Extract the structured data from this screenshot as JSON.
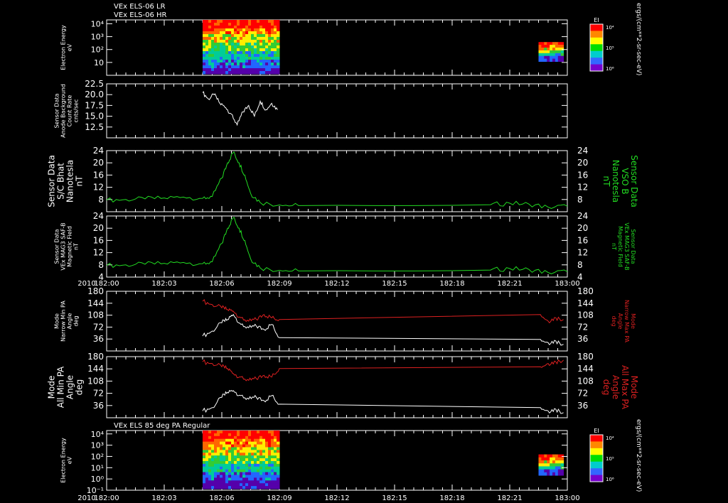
{
  "header": {
    "line1": "VEx ELS-06 LR",
    "line2": "VEx ELS-06 HR",
    "panel7_title": "VEx ELS 85 deg PA Regular"
  },
  "colors": {
    "background": "#000000",
    "axis": "#ffffff",
    "white_trace": "#ffffff",
    "green_trace": "#22dd22",
    "red_trace": "#dd2020"
  },
  "x_axis": {
    "tick_labels": [
      "182:00",
      "182:03",
      "182:06",
      "182:09",
      "182:12",
      "182:15",
      "182:18",
      "182:21",
      "183:00"
    ],
    "year_label": "2010",
    "xlim_minutes": [
      0,
      24
    ]
  },
  "colorbar": {
    "title": "EI",
    "tick_labels": [
      "10⁴",
      "10⁵",
      "10⁶"
    ],
    "units_label": "ergs/(cm**2-sr-sec-eV)"
  },
  "chart_data": [
    {
      "type": "heatmap",
      "ylabel": [
        "Electron Energy",
        "eV"
      ],
      "y_tick_labels": [
        "10⁴",
        "10³",
        "10²",
        "10"
      ],
      "ylim_log10": [
        0,
        4.3
      ],
      "data_intervals_minutes": [
        [
          5.0,
          9.0
        ],
        [
          22.5,
          23.8
        ]
      ]
    },
    {
      "type": "line",
      "ylabel": [
        "Sensor Data",
        "Anode Background",
        "Count Rate",
        "cnts/sec"
      ],
      "y_tick_labels": [
        "22.5",
        "20.0",
        "17.5",
        "15.0",
        "12.5"
      ],
      "ylim": [
        10,
        22.5
      ],
      "series": [
        {
          "color": "white",
          "x": [
            5.0,
            5.3,
            5.6,
            5.9,
            6.2,
            6.5,
            6.8,
            7.1,
            7.4,
            7.7,
            8.0,
            8.3,
            8.6,
            8.9
          ],
          "y": [
            20.5,
            19.0,
            20.0,
            18.0,
            17.0,
            15.5,
            13.0,
            16.0,
            17.5,
            15.0,
            18.5,
            16.5,
            18.0,
            16.5
          ]
        }
      ]
    },
    {
      "type": "line",
      "ylabel": [
        "Sensor Data",
        "S/C Bhat",
        "Nanotesla",
        "nT"
      ],
      "right_label": [
        "Sensor Data",
        "VSO B",
        "Nanotesla",
        "nT"
      ],
      "y_tick_labels": [
        "24",
        "20",
        "16",
        "12",
        "8"
      ],
      "ylim": [
        4,
        24
      ],
      "series": [
        {
          "color": "green",
          "x": [
            0,
            1,
            2,
            3,
            4,
            5,
            5.5,
            6.0,
            6.3,
            6.6,
            6.9,
            7.2,
            7.5,
            8.0,
            9,
            10,
            12,
            14,
            16,
            18,
            20,
            21,
            22,
            23,
            24
          ],
          "y": [
            7.8,
            8.0,
            8.2,
            8.5,
            8.8,
            8.4,
            9.0,
            15.0,
            20.0,
            23.5,
            20.0,
            16.0,
            10.0,
            7.0,
            6.2,
            6.0,
            6.1,
            6.0,
            6.0,
            6.1,
            6.3,
            6.8,
            6.5,
            5.5,
            5.8
          ]
        }
      ]
    },
    {
      "type": "line",
      "ylabel": [
        "Sensor Data",
        "VEx MAG3 SAF-B",
        "Magnetic Field",
        "nT"
      ],
      "right_label": [
        "Sensor Data",
        "VEx MAG3 SAF-B",
        "Magnetic Field",
        "nT"
      ],
      "y_tick_labels": [
        "24",
        "20",
        "16",
        "12",
        "8",
        "4"
      ],
      "ylim": [
        4,
        24
      ],
      "series": [
        {
          "color": "green",
          "x": [
            0,
            1,
            2,
            3,
            4,
            5,
            5.5,
            6.0,
            6.3,
            6.6,
            6.9,
            7.2,
            7.5,
            8.0,
            9,
            10,
            12,
            14,
            16,
            18,
            20,
            21,
            22,
            23,
            24
          ],
          "y": [
            7.8,
            8.0,
            8.2,
            8.5,
            8.8,
            8.4,
            9.0,
            15.0,
            20.0,
            23.5,
            20.0,
            16.0,
            10.0,
            7.0,
            6.2,
            6.0,
            6.1,
            6.0,
            6.0,
            6.1,
            6.3,
            6.8,
            6.5,
            5.5,
            5.8
          ]
        }
      ]
    },
    {
      "type": "line",
      "ylabel": [
        "Mode",
        "Narrow Min PA",
        "Angle",
        "deg"
      ],
      "right_label": [
        "Mode",
        "Narrow Max PA",
        "Angle",
        "deg"
      ],
      "y_tick_labels": [
        "180",
        "144",
        "108",
        "72",
        "36"
      ],
      "ylim": [
        0,
        180
      ],
      "series": [
        {
          "color": "white",
          "x": [
            5.0,
            5.5,
            6.0,
            6.3,
            6.6,
            7.0,
            7.4,
            7.8,
            8.2,
            8.6,
            9.0,
            22.6,
            23.0,
            23.4,
            23.8
          ],
          "y": [
            45,
            60,
            85,
            95,
            110,
            80,
            70,
            75,
            65,
            80,
            40,
            35,
            25,
            30,
            20
          ]
        },
        {
          "color": "red",
          "x": [
            5.0,
            5.5,
            6.0,
            6.3,
            6.6,
            7.0,
            7.4,
            7.8,
            8.2,
            8.6,
            9.0,
            22.6,
            23.0,
            23.4,
            23.8
          ],
          "y": [
            150,
            140,
            130,
            125,
            120,
            100,
            90,
            95,
            110,
            100,
            95,
            110,
            90,
            100,
            95
          ]
        }
      ]
    },
    {
      "type": "line",
      "ylabel": [
        "Mode",
        "All Min PA",
        "Angle",
        "deg"
      ],
      "right_label": [
        "Mode",
        "All Max PA",
        "Angle",
        "deg"
      ],
      "y_tick_labels": [
        "180",
        "144",
        "108",
        "72",
        "36"
      ],
      "ylim": [
        0,
        180
      ],
      "series": [
        {
          "color": "white",
          "x": [
            5.0,
            5.5,
            6.0,
            6.3,
            6.6,
            7.0,
            7.4,
            7.8,
            8.2,
            8.6,
            9.0,
            22.6,
            23.0,
            23.4,
            23.8
          ],
          "y": [
            20,
            30,
            60,
            75,
            80,
            65,
            55,
            60,
            50,
            65,
            40,
            30,
            20,
            25,
            15
          ]
        },
        {
          "color": "red",
          "x": [
            5.0,
            5.5,
            6.0,
            6.3,
            6.6,
            7.0,
            7.4,
            7.8,
            8.2,
            8.6,
            9.0,
            22.6,
            23.0,
            23.4,
            23.8
          ],
          "y": [
            165,
            160,
            150,
            145,
            130,
            120,
            110,
            115,
            125,
            120,
            145,
            150,
            160,
            165,
            170
          ]
        }
      ]
    },
    {
      "type": "heatmap",
      "ylabel": [
        "Electron Energy",
        "eV"
      ],
      "y_tick_labels": [
        "10⁴",
        "10³",
        "10²",
        "10¹",
        "10⁰",
        "10⁻¹"
      ],
      "ylim_log10": [
        -1,
        4.3
      ],
      "data_intervals_minutes": [
        [
          5.0,
          9.0
        ],
        [
          22.5,
          23.8
        ]
      ]
    }
  ]
}
